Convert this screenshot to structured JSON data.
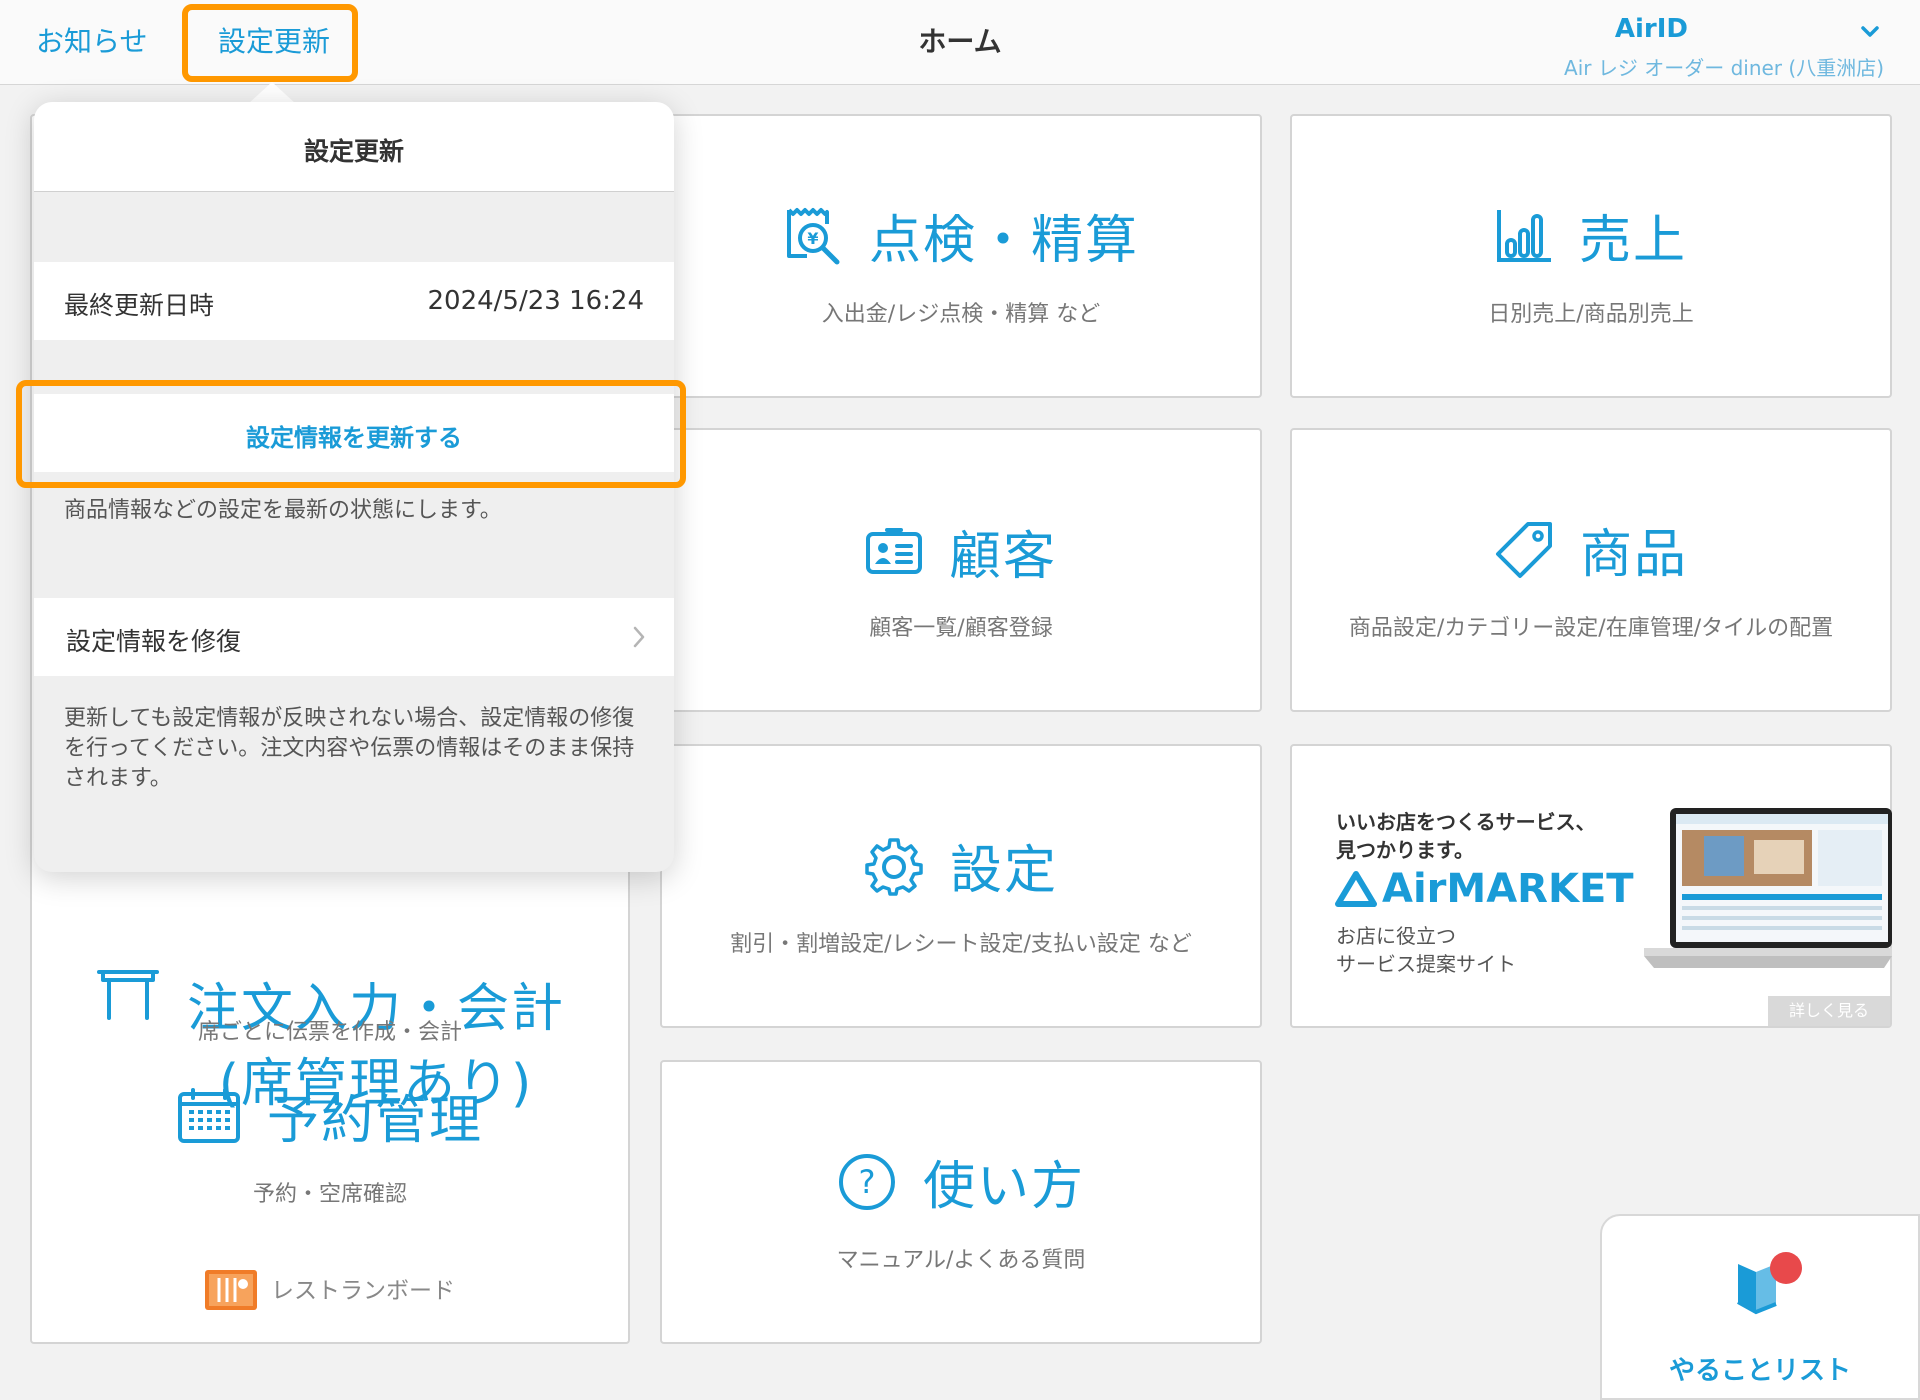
{
  "header": {
    "notice_label": "お知らせ",
    "update_label": "設定更新",
    "title": "ホーム",
    "account_id": "AirID",
    "store_name": "Air レジ オーダー diner (八重洲店)"
  },
  "popover": {
    "title": "設定更新",
    "last_update_label": "最終更新日時",
    "last_update_value": "2024/5/23 16:24",
    "update_action": "設定情報を更新する",
    "update_note": "商品情報などの設定を最新の状態にします。",
    "repair_action": "設定情報を修復",
    "repair_note": "更新しても設定情報が反映されない場合、設定情報の修復を行ってください。注文内容や伝票の情報はそのまま保持されます。"
  },
  "tiles": {
    "check": {
      "title": "点検・精算",
      "sub": "入出金/レジ点検・精算 など",
      "icon": "receipt-search-icon"
    },
    "sales": {
      "title": "売上",
      "sub": "日別売上/商品別売上",
      "icon": "bar-chart-icon"
    },
    "customer": {
      "title": "顧客",
      "sub": "顧客一覧/顧客登録",
      "icon": "id-card-icon"
    },
    "product": {
      "title": "商品",
      "sub": "商品設定/カテゴリー設定/在庫管理/タイルの配置",
      "icon": "tag-icon"
    },
    "settings": {
      "title": "設定",
      "sub": "割引・割増設定/レシート設定/支払い設定 など",
      "icon": "gear-icon"
    },
    "help": {
      "title": "使い方",
      "sub": "マニュアル/よくある質問",
      "icon": "question-circle-icon"
    },
    "order": {
      "title_line1": "注文入力・会計",
      "title_line2": "(席管理あり)",
      "sub": "席ごとに伝票を作成・会計",
      "icon": "table-icon"
    },
    "reservation": {
      "title": "予約管理",
      "sub": "予約・空席確認",
      "icon": "calendar-icon"
    },
    "board": {
      "label": "レストランボード",
      "icon": "restaurant-board-icon"
    }
  },
  "banner": {
    "line1": "いいお店をつくるサービス、",
    "line2": "見つかります。",
    "logo": "AirMARKET",
    "line3": "お店に役立つ",
    "line4": "サービス提案サイト",
    "more": "詳しく見る"
  },
  "todo": {
    "label": "やることリスト"
  },
  "colors": {
    "accent": "#1a9bd7",
    "highlight": "#ff9800",
    "badge": "#e8494b"
  }
}
